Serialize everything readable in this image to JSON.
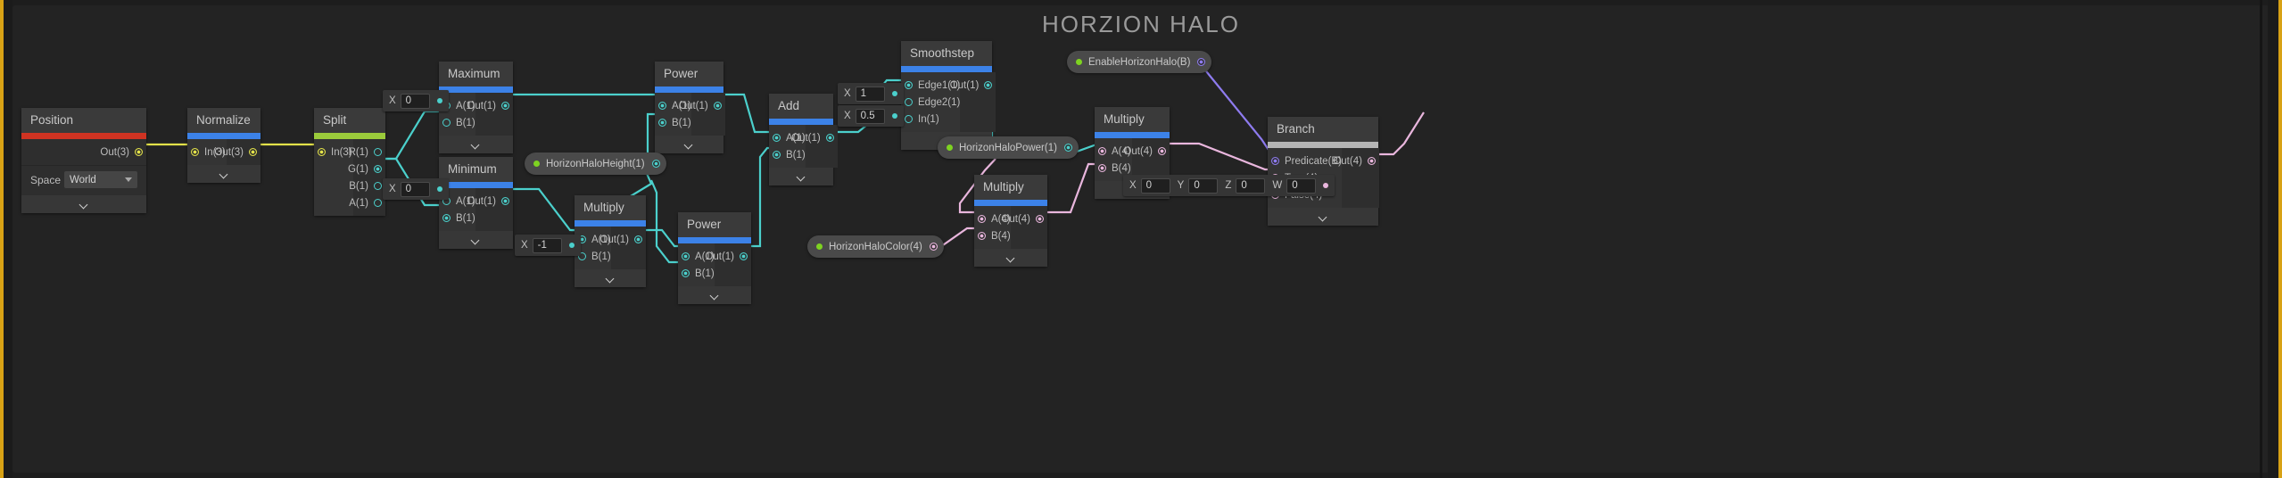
{
  "title": "HORZION HALO",
  "theme": {
    "canvas_bg": "#232323",
    "node_bg": "#2b2b2b",
    "accent_math": "#3c82e8",
    "accent_input": "#cf3322",
    "accent_channel": "#9bcb3b",
    "accent_utility": "#b4b4b4",
    "wire_float": "#4bd0cc",
    "wire_vector3": "#e3e24a",
    "wire_vector4": "#e9b6dd",
    "wire_bool": "#8e7bef",
    "frame_edge": "#d8a215"
  },
  "nodes": [
    {
      "id": "position",
      "name": "Position",
      "accent": "input",
      "outputs": [
        "Out(3)"
      ],
      "property": {
        "label": "Space",
        "value": "World"
      }
    },
    {
      "id": "normalize",
      "name": "Normalize",
      "accent": "math",
      "inputs": [
        "In(3)"
      ],
      "outputs": [
        "Out(3)"
      ]
    },
    {
      "id": "split",
      "name": "Split",
      "accent": "channel",
      "inputs": [
        "In(3)"
      ],
      "outputs": [
        "R(1)",
        "G(1)",
        "B(1)",
        "A(1)"
      ]
    },
    {
      "id": "maximum",
      "name": "Maximum",
      "accent": "math",
      "inputs": [
        "A(1)",
        "B(1)"
      ],
      "outputs": [
        "Out(1)"
      ]
    },
    {
      "id": "minimum",
      "name": "Minimum",
      "accent": "math",
      "inputs": [
        "A(1)",
        "B(1)"
      ],
      "outputs": [
        "Out(1)"
      ]
    },
    {
      "id": "power-top",
      "name": "Power",
      "accent": "math",
      "inputs": [
        "A(1)",
        "B(1)"
      ],
      "outputs": [
        "Out(1)"
      ]
    },
    {
      "id": "multiply-neg",
      "name": "Multiply",
      "accent": "math",
      "inputs": [
        "A(1)",
        "B(1)"
      ],
      "outputs": [
        "Out(1)"
      ]
    },
    {
      "id": "power-bottom",
      "name": "Power",
      "accent": "math",
      "inputs": [
        "A(1)",
        "B(1)"
      ],
      "outputs": [
        "Out(1)"
      ]
    },
    {
      "id": "add",
      "name": "Add",
      "accent": "math",
      "inputs": [
        "A(1)",
        "B(1)"
      ],
      "outputs": [
        "Out(1)"
      ]
    },
    {
      "id": "smoothstep",
      "name": "Smoothstep",
      "accent": "math",
      "inputs": [
        "Edge1(1)",
        "Edge2(1)",
        "In(1)"
      ],
      "outputs": [
        "Out(1)"
      ]
    },
    {
      "id": "multiply-color",
      "name": "Multiply",
      "accent": "math",
      "inputs": [
        "A(4)",
        "B(4)"
      ],
      "outputs": [
        "Out(4)"
      ]
    },
    {
      "id": "multiply-final",
      "name": "Multiply",
      "accent": "math",
      "inputs": [
        "A(4)",
        "B(4)"
      ],
      "outputs": [
        "Out(4)"
      ]
    },
    {
      "id": "branch",
      "name": "Branch",
      "accent": "utility",
      "inputs": [
        "Predicate(B)",
        "True(4)",
        "False(4)"
      ],
      "outputs": [
        "Out(4)"
      ]
    }
  ],
  "value_nodes": [
    {
      "id": "val-max-x",
      "axis": "X",
      "value": "0"
    },
    {
      "id": "val-min-x",
      "axis": "X",
      "value": "0"
    },
    {
      "id": "val-mul-x",
      "axis": "X",
      "value": "-1"
    },
    {
      "id": "val-edge2-x",
      "axis": "X",
      "value": "1"
    },
    {
      "id": "val-in-x",
      "axis": "X",
      "value": "0.5"
    }
  ],
  "vector4_node": {
    "id": "val-branch-false",
    "channels": [
      {
        "axis": "X",
        "value": "0"
      },
      {
        "axis": "Y",
        "value": "0"
      },
      {
        "axis": "Z",
        "value": "0"
      },
      {
        "axis": "W",
        "value": "0"
      }
    ]
  },
  "property_pills": [
    {
      "id": "pill-height",
      "label": "HorizonHaloHeight(1)",
      "port_type": "float"
    },
    {
      "id": "pill-power",
      "label": "HorizonHaloPower(1)",
      "port_type": "float"
    },
    {
      "id": "pill-color",
      "label": "HorizonHaloColor(4)",
      "port_type": "vector4"
    },
    {
      "id": "pill-enable",
      "label": "EnableHorizonHalo(B)",
      "port_type": "bool"
    }
  ]
}
